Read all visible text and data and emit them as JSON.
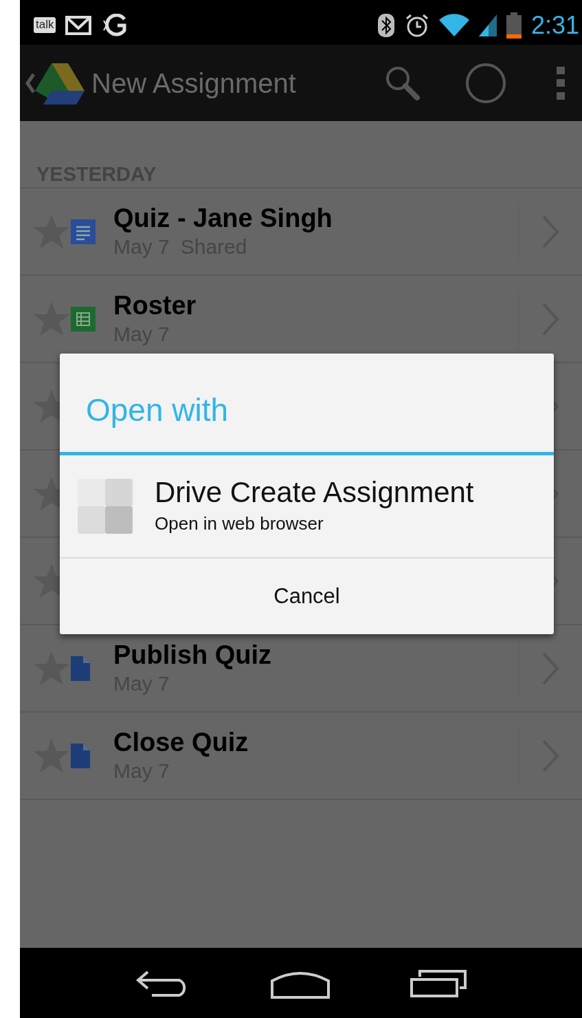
{
  "status_bar": {
    "talk_label": "talk",
    "time": "2:31"
  },
  "action_bar": {
    "title": "New Assignment"
  },
  "list": {
    "section_header": "YESTERDAY",
    "rows": [
      {
        "title": "Quiz - Jane Singh",
        "date": "May 7",
        "shared": "Shared",
        "kind": "document",
        "starred": false
      },
      {
        "title": "Roster",
        "date": "May 7",
        "kind": "spreadsheet",
        "starred": false
      },
      {
        "kind": "hidden",
        "starred": false
      },
      {
        "kind": "hidden",
        "starred": false
      },
      {
        "kind": "hidden",
        "starred": false
      },
      {
        "title": "Publish Quiz",
        "date": "May 7",
        "kind": "file",
        "starred": false
      },
      {
        "title": "Close Quiz",
        "date": "May 7",
        "kind": "file",
        "starred": false
      }
    ]
  },
  "dialog": {
    "title": "Open with",
    "options": [
      {
        "label": "Drive Create Assignment",
        "sublabel": "Open in web browser"
      }
    ],
    "cancel": "Cancel"
  }
}
